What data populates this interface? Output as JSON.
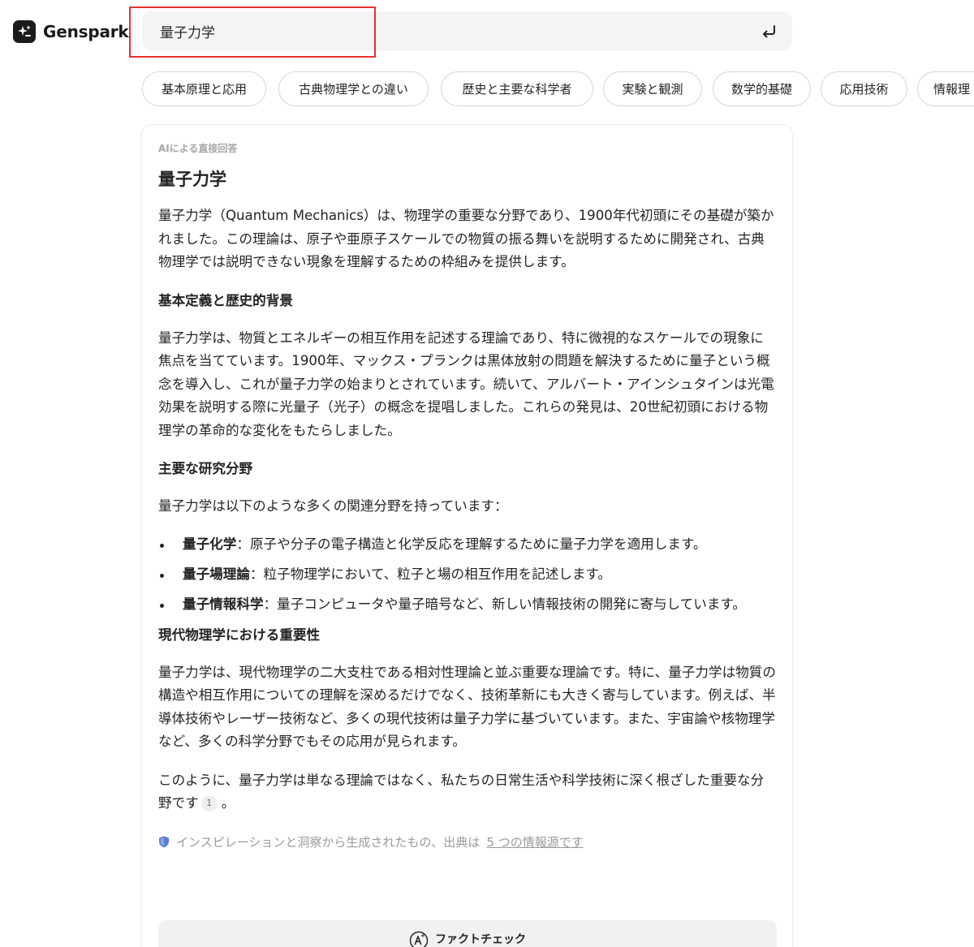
{
  "app": {
    "name": "Genspark"
  },
  "search": {
    "value": "量子力学"
  },
  "chips": [
    {
      "label": "基本原理と応用"
    },
    {
      "label": "古典物理学との違い"
    },
    {
      "label": "歴史と主要な科学者"
    },
    {
      "label": "実験と観測"
    },
    {
      "label": "数学的基礎"
    },
    {
      "label": "応用技術"
    },
    {
      "label": "情報理"
    }
  ],
  "answer": {
    "label": "AIによる直接回答",
    "title": "量子力学",
    "intro": "量子力学（Quantum Mechanics）は、物理学の重要な分野であり、1900年代初頭にその基礎が築かれました。この理論は、原子や亜原子スケールでの物質の振る舞いを説明するために開発され、古典物理学では説明できない現象を理解するための枠組みを提供します。",
    "sections": [
      {
        "heading": "基本定義と歴史的背景",
        "text": "量子力学は、物質とエネルギーの相互作用を記述する理論であり、特に微視的なスケールでの現象に焦点を当てています。1900年、マックス・プランクは黒体放射の問題を解決するために量子という概念を導入し、これが量子力学の始まりとされています。続いて、アルバート・アインシュタインは光電効果を説明する際に光量子（光子）の概念を提唱しました。これらの発見は、20世紀初頭における物理学の革命的な変化をもたらしました。"
      },
      {
        "heading": "主要な研究分野",
        "text": "量子力学は以下のような多くの関連分野を持っています：",
        "items": [
          {
            "term": "量子化学",
            "desc": "：原子や分子の電子構造と化学反応を理解するために量子力学を適用します。"
          },
          {
            "term": "量子場理論",
            "desc": "：粒子物理学において、粒子と場の相互作用を記述します。"
          },
          {
            "term": "量子情報科学",
            "desc": "：量子コンピュータや量子暗号など、新しい情報技術の開発に寄与しています。"
          }
        ]
      },
      {
        "heading": "現代物理学における重要性",
        "text": "量子力学は、現代物理学の二大支柱である相対性理論と並ぶ重要な理論です。特に、量子力学は物質の構造や相互作用についての理解を深めるだけでなく、技術革新にも大きく寄与しています。例えば、半導体技術やレーザー技術など、多くの現代技術は量子力学に基づいています。また、宇宙論や核物理学など、多くの科学分野でもその応用が見られます。"
      }
    ],
    "conclusion": "このように、量子力学は単なる理論ではなく、私たちの日常生活や科学技術に深く根ざした重要な分野です",
    "citation": "1",
    "conclusion_end": "。",
    "footnote_text": "インスピレーションと洞察から生成されたもの、出典は",
    "footnote_link": "5 つの情報源です",
    "factcheck_label": "ファクトチェック"
  },
  "colors": {
    "highlight": "#e8302b",
    "search_bg": "#f4f4f4",
    "shield": "#5b7fd6"
  }
}
